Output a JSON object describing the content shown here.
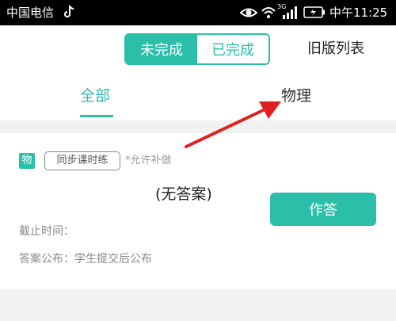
{
  "status_bar": {
    "carrier": "中国电信",
    "network": "3G",
    "time": "中午11:25"
  },
  "header": {
    "segment_unfinished": "未完成",
    "segment_finished": "已完成",
    "old_list": "旧版列表"
  },
  "tabs": [
    {
      "label": "全部",
      "active": true
    },
    {
      "label": "物理",
      "active": false
    }
  ],
  "assignment": {
    "subject_badge": "物",
    "tag": "同步课时练",
    "allow_note": "*允许补做",
    "answer_status": "(无答案)",
    "answer_button": "作答",
    "deadline": "截止时间：",
    "publish": "答案公布：学生提交后公布"
  },
  "colors": {
    "accent": "#2bbfa9",
    "arrow": "#e02020"
  }
}
